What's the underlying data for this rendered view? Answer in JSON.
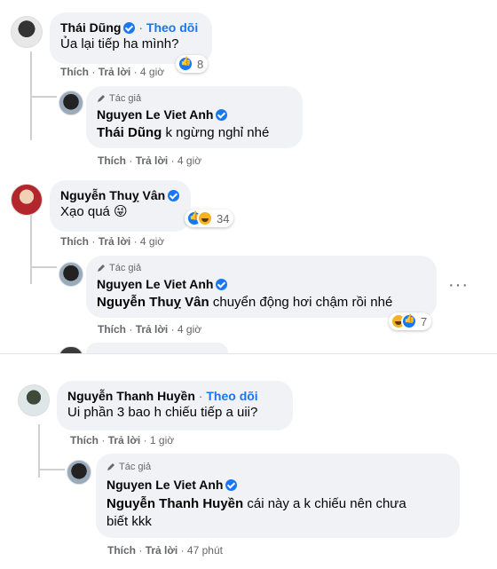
{
  "comments": [
    {
      "name": "Thái Dũng",
      "follow": "Theo dõi",
      "separator": "·",
      "text": "Ủa lại tiếp ha mình?",
      "like": "Thích",
      "reply": "Trả lời",
      "time": "4 giờ",
      "reactions": "8"
    },
    {
      "author_tag": "Tác giả",
      "name": "Nguyen Le Viet Anh",
      "mention": "Thái Dũng",
      "text": " k ngừng nghỉ nhé",
      "like": "Thích",
      "reply": "Trả lời",
      "time": "4 giờ"
    },
    {
      "name": "Nguyễn Thuỵ Vân",
      "text": "Xạo quá 😜",
      "like": "Thích",
      "reply": "Trả lời",
      "time": "4 giờ",
      "reactions": "34"
    },
    {
      "author_tag": "Tác giả",
      "name": "Nguyen Le Viet Anh",
      "mention": "Nguyễn Thuỵ Vân",
      "text": " chuyển động hơi chậm rồi nhé",
      "like": "Thích",
      "reply": "Trả lời",
      "time": "4 giờ",
      "reactions": "7",
      "more": "···"
    },
    {
      "name": "Nguyễn Thanh Huyền",
      "follow": "Theo dõi",
      "separator": "·",
      "text": "Ui phần 3 bao h chiếu tiếp a uii?",
      "like": "Thích",
      "reply": "Trả lời",
      "time": "1 giờ"
    },
    {
      "author_tag": "Tác giả",
      "name": "Nguyen Le Viet Anh",
      "mention": "Nguyễn Thanh Huyền",
      "text_line1": " cái này a k chiếu nên chưa",
      "text_line2": "biết kkk",
      "like": "Thích",
      "reply": "Trả lời",
      "time": "47 phút"
    }
  ],
  "actions_separator": "·",
  "colors": {
    "bubble": "#f0f2f5",
    "link": "#1877f2",
    "muted": "#65676b"
  }
}
